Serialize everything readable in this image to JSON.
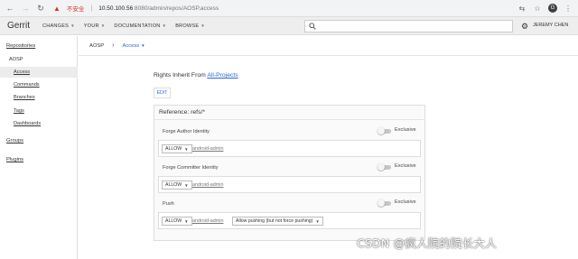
{
  "browser": {
    "insecure_label": "不安全",
    "url_host": "10.50.100.56",
    "url_path": ":8080/admin/repos/AOSP,access",
    "avatar_letter": "G"
  },
  "header": {
    "logo": "Gerrit",
    "menu": [
      "CHANGES",
      "YOUR",
      "DOCUMENTATION",
      "BROWSE"
    ],
    "search_placeholder": "",
    "user": "JEREMY CHEN"
  },
  "sidebar": {
    "repositories": "Repositories",
    "repo": "AOSP",
    "items": [
      "Access",
      "Commands",
      "Branches",
      "Tags",
      "Dashboards"
    ],
    "groups": "Groups",
    "plugins": "Plugins"
  },
  "breadcrumb": {
    "repo": "AOSP",
    "sep": "›",
    "section": "Access"
  },
  "access": {
    "rights_prefix": "Rights Inherit From",
    "rights_link": "All-Projects",
    "edit_label": "EDIT",
    "reference_title": "Reference: refs/*",
    "exclusive_label": "Exclusive",
    "permissions": [
      {
        "name": "Forge Author Identity",
        "action": "ALLOW",
        "group": "android-admin"
      },
      {
        "name": "Forge Committer Identity",
        "action": "ALLOW",
        "group": "android-admin"
      },
      {
        "name": "Push",
        "action": "ALLOW",
        "group": "android-admin",
        "option": "Allow pushing (but not force pushing)"
      }
    ]
  },
  "watermark": "CSDN @疯人院的院长大人"
}
